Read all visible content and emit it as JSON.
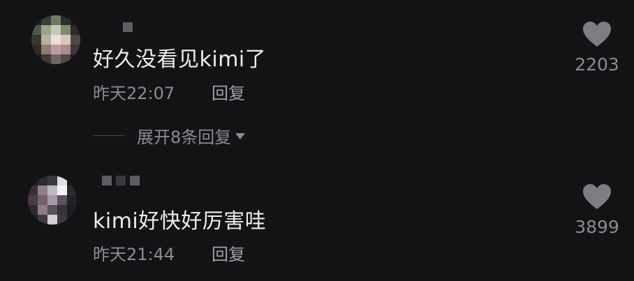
{
  "comments": [
    {
      "text": "好久没看见kimi了",
      "time": "昨天22:07",
      "reply_label": "回复",
      "likes": "2203",
      "avatar_colors": [
        "#1e1f1e",
        "#3a3d37",
        "#6f7a64",
        "#2b2f2d",
        "#1c1c1c",
        "#4e5a47",
        "#9aa38a",
        "#c7c9b8",
        "#7d8b6e",
        "#2a2a2a",
        "#38362f",
        "#b7b2a0",
        "#e9e2d8",
        "#d8c7be",
        "#4a4a45",
        "#2d2c28",
        "#8c7f75",
        "#c29aa0",
        "#b08a8e",
        "#3c3a38",
        "#1c1c1c",
        "#3d3a38",
        "#6d6663",
        "#4f4a48",
        "#1e1e1e"
      ]
    },
    {
      "text": "kimi好快好厉害哇",
      "time": "昨天21:44",
      "reply_label": "回复",
      "likes": "3899",
      "avatar_colors": [
        "#1d1d1f",
        "#2b2a2e",
        "#3a3a3e",
        "#e0e0e4",
        "#1c1c1e",
        "#3a3036",
        "#8a7f8a",
        "#bfb7c0",
        "#f2f2f4",
        "#2a2a2c",
        "#4a3c44",
        "#7a5f6e",
        "#a897a6",
        "#5e5060",
        "#222224",
        "#2f2a2e",
        "#8e7b8a",
        "#5c4e58",
        "#36323a",
        "#1e1e20",
        "#1c1c1e",
        "#403a42",
        "#d5cfd4",
        "#3e3840",
        "#1c1c1e"
      ]
    }
  ],
  "expand_replies": "展开8条回复",
  "colors": {
    "background": "#131316",
    "heart": "#7d7d82"
  }
}
